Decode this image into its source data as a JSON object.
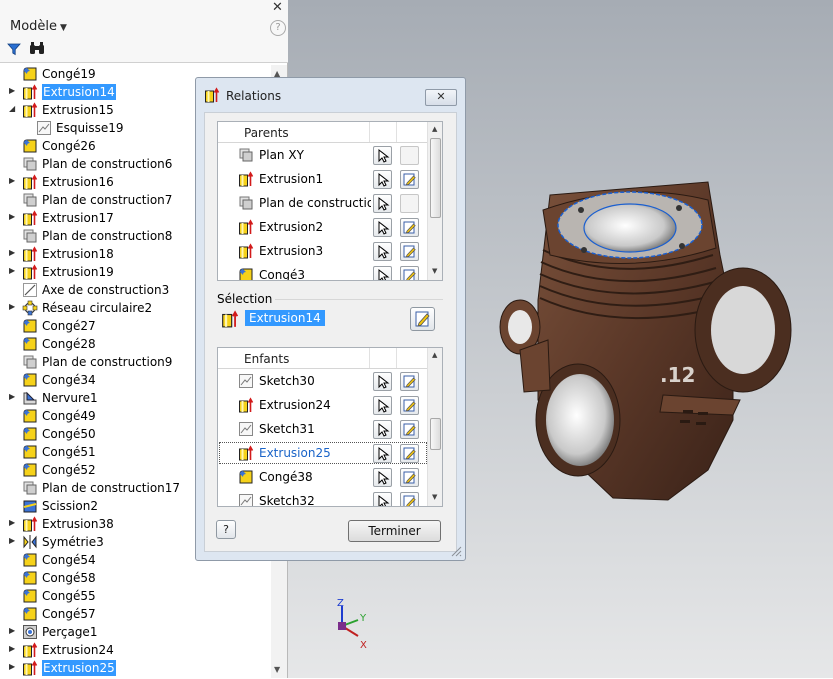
{
  "browser": {
    "title": "Modèle",
    "close_glyph": "✕",
    "help_glyph": "?",
    "icons": [
      "filter-icon",
      "find-icon"
    ],
    "tree": [
      {
        "label": "Congé19",
        "icon": "fillet",
        "expand": "",
        "indent": 0,
        "selected": false
      },
      {
        "label": "Extrusion14",
        "icon": "extrusion",
        "expand": "▶",
        "indent": 0,
        "selected": true
      },
      {
        "label": "Extrusion15",
        "icon": "extrusion",
        "expand": "◢",
        "indent": 0,
        "selected": false
      },
      {
        "label": "Esquisse19",
        "icon": "sketch",
        "expand": "",
        "indent": 1,
        "selected": false
      },
      {
        "label": "Congé26",
        "icon": "fillet",
        "expand": "",
        "indent": 0,
        "selected": false
      },
      {
        "label": "Plan de construction6",
        "icon": "plane",
        "expand": "",
        "indent": 0,
        "selected": false
      },
      {
        "label": "Extrusion16",
        "icon": "extrusion",
        "expand": "▶",
        "indent": 0,
        "selected": false
      },
      {
        "label": "Plan de construction7",
        "icon": "plane",
        "expand": "",
        "indent": 0,
        "selected": false
      },
      {
        "label": "Extrusion17",
        "icon": "extrusion",
        "expand": "▶",
        "indent": 0,
        "selected": false
      },
      {
        "label": "Plan de construction8",
        "icon": "plane",
        "expand": "",
        "indent": 0,
        "selected": false
      },
      {
        "label": "Extrusion18",
        "icon": "extrusion",
        "expand": "▶",
        "indent": 0,
        "selected": false
      },
      {
        "label": "Extrusion19",
        "icon": "extrusion",
        "expand": "▶",
        "indent": 0,
        "selected": false
      },
      {
        "label": "Axe de construction3",
        "icon": "axis",
        "expand": "",
        "indent": 0,
        "selected": false
      },
      {
        "label": "Réseau circulaire2",
        "icon": "pattern",
        "expand": "▶",
        "indent": 0,
        "selected": false
      },
      {
        "label": "Congé27",
        "icon": "fillet",
        "expand": "",
        "indent": 0,
        "selected": false
      },
      {
        "label": "Congé28",
        "icon": "fillet",
        "expand": "",
        "indent": 0,
        "selected": false
      },
      {
        "label": "Plan de construction9",
        "icon": "plane",
        "expand": "",
        "indent": 0,
        "selected": false
      },
      {
        "label": "Congé34",
        "icon": "fillet",
        "expand": "",
        "indent": 0,
        "selected": false
      },
      {
        "label": "Nervure1",
        "icon": "rib",
        "expand": "▶",
        "indent": 0,
        "selected": false
      },
      {
        "label": "Congé49",
        "icon": "fillet",
        "expand": "",
        "indent": 0,
        "selected": false
      },
      {
        "label": "Congé50",
        "icon": "fillet",
        "expand": "",
        "indent": 0,
        "selected": false
      },
      {
        "label": "Congé51",
        "icon": "fillet",
        "expand": "",
        "indent": 0,
        "selected": false
      },
      {
        "label": "Congé52",
        "icon": "fillet",
        "expand": "",
        "indent": 0,
        "selected": false
      },
      {
        "label": "Plan de construction17",
        "icon": "plane",
        "expand": "",
        "indent": 0,
        "selected": false
      },
      {
        "label": "Scission2",
        "icon": "split",
        "expand": "",
        "indent": 0,
        "selected": false
      },
      {
        "label": "Extrusion38",
        "icon": "extrusion",
        "expand": "▶",
        "indent": 0,
        "selected": false
      },
      {
        "label": "Symétrie3",
        "icon": "mirror",
        "expand": "▶",
        "indent": 0,
        "selected": false
      },
      {
        "label": "Congé54",
        "icon": "fillet",
        "expand": "",
        "indent": 0,
        "selected": false
      },
      {
        "label": "Congé58",
        "icon": "fillet",
        "expand": "",
        "indent": 0,
        "selected": false
      },
      {
        "label": "Congé55",
        "icon": "fillet",
        "expand": "",
        "indent": 0,
        "selected": false
      },
      {
        "label": "Congé57",
        "icon": "fillet",
        "expand": "",
        "indent": 0,
        "selected": false
      },
      {
        "label": "Perçage1",
        "icon": "hole",
        "expand": "▶",
        "indent": 0,
        "selected": false
      },
      {
        "label": "Extrusion24",
        "icon": "extrusion",
        "expand": "▶",
        "indent": 0,
        "selected": false
      },
      {
        "label": "Extrusion25",
        "icon": "extrusion",
        "expand": "▶",
        "indent": 0,
        "selected": true
      }
    ]
  },
  "dialog": {
    "title": "Relations",
    "close_glyph": "✕",
    "parents": {
      "header": "Parents",
      "items": [
        {
          "name": "Plan XY",
          "icon": "plane",
          "edit": false
        },
        {
          "name": "Extrusion1",
          "icon": "extrusion",
          "edit": true
        },
        {
          "name": "Plan de construction",
          "icon": "plane",
          "edit": false
        },
        {
          "name": "Extrusion2",
          "icon": "extrusion",
          "edit": true
        },
        {
          "name": "Extrusion3",
          "icon": "extrusion",
          "edit": true
        },
        {
          "name": "Congé3",
          "icon": "fillet",
          "edit": true
        }
      ]
    },
    "selection": {
      "label": "Sélection",
      "value": "Extrusion14"
    },
    "children": {
      "header": "Enfants",
      "items": [
        {
          "name": "Sketch30",
          "icon": "sketch",
          "edit": true,
          "focus": false
        },
        {
          "name": "Extrusion24",
          "icon": "extrusion",
          "edit": true,
          "focus": false
        },
        {
          "name": "Sketch31",
          "icon": "sketch",
          "edit": true,
          "focus": false
        },
        {
          "name": "Extrusion25",
          "icon": "extrusion",
          "edit": true,
          "focus": true
        },
        {
          "name": "Congé38",
          "icon": "fillet",
          "edit": true,
          "focus": false
        },
        {
          "name": "Sketch32",
          "icon": "sketch",
          "edit": true,
          "focus": false
        }
      ]
    },
    "help_label": "?",
    "finish_label": "Terminer"
  },
  "viewport": {
    "part_label": ".12",
    "axes": {
      "x": "X",
      "y": "Y",
      "z": "Z"
    }
  },
  "colors": {
    "selection": "#3399ff",
    "part": "#5b3828",
    "viewport_top": "#a6acb4",
    "dialog_bg": "#dde6f1"
  }
}
